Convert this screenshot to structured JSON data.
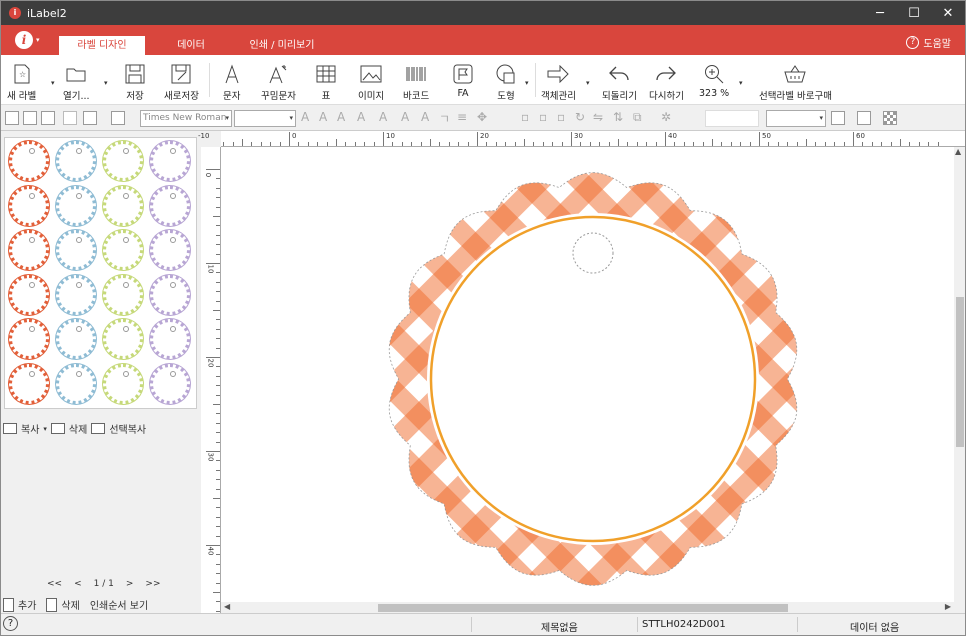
{
  "window": {
    "title": "iLabel2",
    "minimize": "─",
    "maximize": "☐",
    "close": "✕"
  },
  "ribbon": {
    "app_icon": "i",
    "tabs": [
      {
        "label": "라벨 디자인",
        "active": true
      },
      {
        "label": "데이터"
      },
      {
        "label": "인쇄 / 미리보기"
      }
    ],
    "help_label": "도움말",
    "color": "#d9463d"
  },
  "toolbar": {
    "items": [
      {
        "label": "새 라벨",
        "icon": "new-label-icon"
      },
      {
        "label": "열기...",
        "icon": "open-folder-icon"
      },
      {
        "label": "저장",
        "icon": "save-icon"
      },
      {
        "label": "새로저장",
        "icon": "save-as-icon"
      },
      {
        "label": "문자",
        "icon": "text-icon"
      },
      {
        "label": "꾸밈문자",
        "icon": "fancy-text-icon"
      },
      {
        "label": "표",
        "icon": "table-icon"
      },
      {
        "label": "이미지",
        "icon": "image-icon"
      },
      {
        "label": "바코드",
        "icon": "barcode-icon"
      },
      {
        "label": "FA",
        "icon": "fa-icon"
      },
      {
        "label": "도형",
        "icon": "shape-icon"
      },
      {
        "label": "객체관리",
        "icon": "object-manage-icon"
      },
      {
        "label": "되돌리기",
        "icon": "undo-icon"
      },
      {
        "label": "다시하기",
        "icon": "redo-icon"
      },
      {
        "label": "323 %",
        "icon": "zoom-icon"
      },
      {
        "label": "선택라벨 바로구매",
        "icon": "basket-icon"
      }
    ]
  },
  "format_bar": {
    "font_name": "Times New Roman",
    "font_size": ""
  },
  "ruler": {
    "top_labels": [
      "-10",
      "0",
      "10",
      "20",
      "30",
      "40",
      "50",
      "60"
    ],
    "left_labels": [
      "0",
      "10",
      "20",
      "30",
      "40"
    ]
  },
  "left_panel": {
    "copy_label": "복사",
    "delete_label": "삭제",
    "select_copy_label": "선택복사",
    "pager": {
      "first": "<<",
      "prev": "<",
      "page": "1 / 1",
      "next": ">",
      "last": ">>"
    },
    "add_label": "추가",
    "remove_label": "삭제",
    "print_order_label": "인쇄순서 보기",
    "thumb_colors": [
      "#e2603a",
      "#8fbcd4",
      "#c6d97a",
      "#b8a6d4"
    ]
  },
  "canvas": {
    "accent": "#ef6a2a",
    "ring": "#f0a02a"
  },
  "status": {
    "title": "제목없음",
    "code": "STTLH0242D001",
    "data": "데이터 없음"
  }
}
